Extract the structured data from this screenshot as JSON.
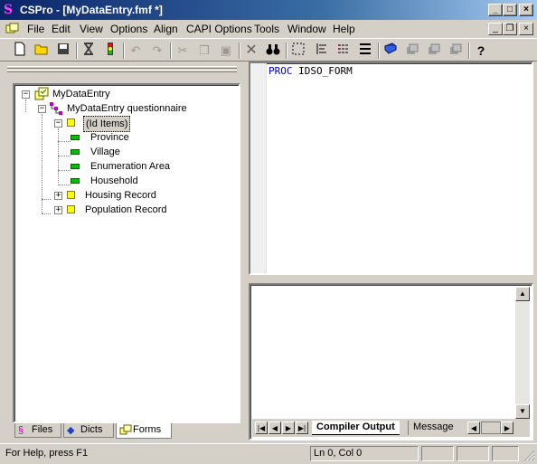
{
  "window": {
    "app_name": "CSPro",
    "document_title": "- [MyDataEntry.fmf *]",
    "minimize": "_",
    "maximize": "□",
    "close": "×"
  },
  "menu": [
    "File",
    "Edit",
    "View",
    "Options",
    "Align",
    "CAPI Options",
    "Tools",
    "Window",
    "Help"
  ],
  "mdi_controls": {
    "minimize": "_",
    "restore": "❐",
    "close": "×"
  },
  "tree": {
    "root": "MyDataEntry",
    "questionnaire": "MyDataEntry questionnaire",
    "id_items": "(Id Items)",
    "id_fields": [
      "Province",
      "Village",
      "Enumeration Area",
      "Household"
    ],
    "records": [
      "Housing Record",
      "Population Record"
    ]
  },
  "left_tabs": [
    "Files",
    "Dicts",
    "Forms"
  ],
  "editor": {
    "keyword": "PROC",
    "identifier": "IDSO_FORM"
  },
  "output_tabs": [
    "Compiler Output",
    "Message"
  ],
  "status": {
    "help": "For Help, press F1",
    "position": "Ln 0, Col 0"
  }
}
